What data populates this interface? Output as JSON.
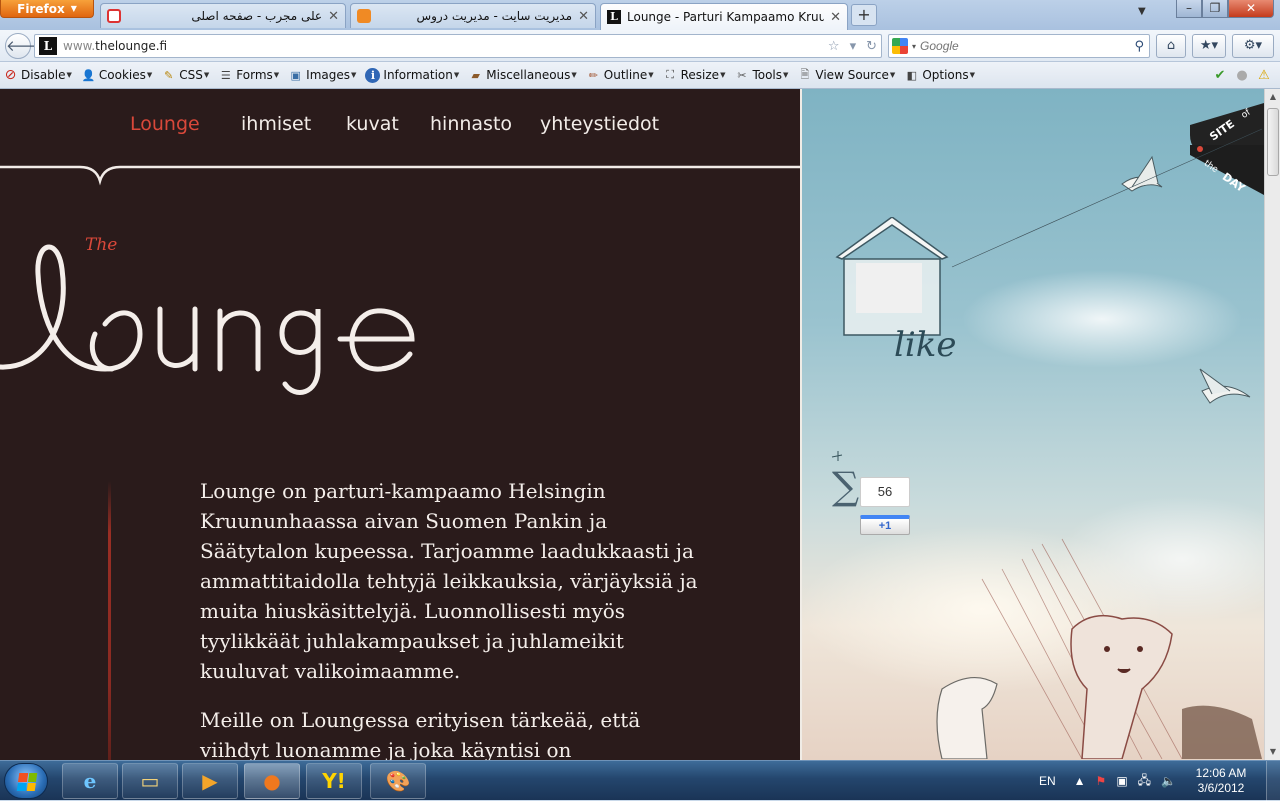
{
  "browser": {
    "menu_button": "Firefox",
    "tabs": [
      {
        "title": "علی مجرب - صفحه اصلی",
        "icon": "red-square-icon"
      },
      {
        "title": "مدیریت سایت - مدیریت دروس",
        "icon": "orange-joomla-icon"
      },
      {
        "title": "Lounge - Parturi Kampaamo Kruunu...",
        "icon": "lounge-l-icon",
        "active": true
      }
    ],
    "new_tab": "+",
    "url_prefix": "www.",
    "url_host": "thelounge.fi",
    "search_placeholder": "Google"
  },
  "devbar": {
    "items": [
      {
        "label": "Disable",
        "icon": "disable-icon"
      },
      {
        "label": "Cookies",
        "icon": "cookies-icon"
      },
      {
        "label": "CSS",
        "icon": "css-icon"
      },
      {
        "label": "Forms",
        "icon": "forms-icon"
      },
      {
        "label": "Images",
        "icon": "images-icon"
      },
      {
        "label": "Information",
        "icon": "information-icon"
      },
      {
        "label": "Miscellaneous",
        "icon": "miscellaneous-icon"
      },
      {
        "label": "Outline",
        "icon": "outline-icon"
      },
      {
        "label": "Resize",
        "icon": "resize-icon"
      },
      {
        "label": "Tools",
        "icon": "tools-icon"
      },
      {
        "label": "View Source",
        "icon": "view-source-icon"
      },
      {
        "label": "Options",
        "icon": "options-icon"
      }
    ]
  },
  "site": {
    "nav": [
      "Lounge",
      "ihmiset",
      "kuvat",
      "hinnasto",
      "yhteystiedot"
    ],
    "logo_small": "The",
    "logo_word": "lounge",
    "paragraph1": "Lounge on parturi-kampaamo Helsingin Kruununhaassa aivan Suomen Pankin ja Säätytalon kupeessa. Tarjoamme laadukkaasti ja ammattitaidolla tehtyjä leikkauksia, värjäyksiä ja muita hiuskäsittelyjä. Luonnollisesti myös tyylikkäät juhlakampaukset ja juhlameikit kuuluvat valikoimaamme.",
    "paragraph2": "Meille on Loungessa erityisen tärkeää, että viihdyt luonamme ja joka käyntisi on",
    "badge_line1": "SITE",
    "badge_of": "of",
    "badge_the": "the",
    "badge_line2": "DAY",
    "like_label": "like",
    "gplus_count": "56",
    "gplus_label": "+1"
  },
  "taskbar": {
    "apps": [
      "internet-explorer",
      "file-explorer",
      "media-player",
      "firefox",
      "yahoo-messenger",
      "paint"
    ],
    "language": "EN",
    "time": "12:06 AM",
    "date": "3/6/2012"
  },
  "colors": {
    "site_background": "#2a1b1b",
    "accent_red": "#d9483a",
    "firefox_orange": "#e0650f"
  }
}
